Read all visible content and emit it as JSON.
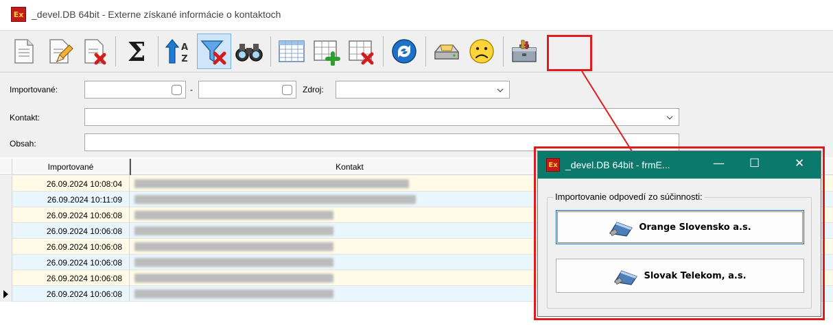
{
  "window": {
    "title": "_devel.DB 64bit - Externe získané informácie o kontaktoch",
    "logo": "Ex"
  },
  "toolbar": {
    "buttons": [
      {
        "icon": "new-document-icon"
      },
      {
        "icon": "edit-document-icon"
      },
      {
        "icon": "delete-document-icon"
      },
      {
        "icon": "sum-icon",
        "glyph": "Σ"
      },
      {
        "icon": "sort-az-icon"
      },
      {
        "icon": "clear-filter-icon",
        "pressed": true
      },
      {
        "icon": "binoculars-icon"
      },
      {
        "icon": "table-icon"
      },
      {
        "icon": "table-add-icon"
      },
      {
        "icon": "table-delete-icon"
      },
      {
        "icon": "refresh-icon"
      },
      {
        "icon": "disk-drive-icon"
      },
      {
        "icon": "sad-face-icon"
      },
      {
        "icon": "toolbox-icon",
        "highlighted": true
      }
    ]
  },
  "filter": {
    "imported_label": "Importované:",
    "dash": "-",
    "source_label": "Zdroj:",
    "contact_label": "Kontakt:",
    "content_label": "Obsah:"
  },
  "grid": {
    "columns": [
      "Importované",
      "Kontakt"
    ],
    "rows": [
      {
        "date": "26.09.2024 10:08:04"
      },
      {
        "date": "26.09.2024 10:11:09"
      },
      {
        "date": "26.09.2024 10:06:08"
      },
      {
        "date": "26.09.2024 10:06:08"
      },
      {
        "date": "26.09.2024 10:06:08"
      },
      {
        "date": "26.09.2024 10:06:08"
      },
      {
        "date": "26.09.2024 10:06:08"
      },
      {
        "date": "26.09.2024 10:06:08",
        "current": true
      }
    ]
  },
  "popup": {
    "title": "_devel.DB 64bit - frmE...",
    "minimize": "—",
    "maximize": "☐",
    "close": "✕",
    "group_label": "Importovanie odpovedí zo súčinnosti:",
    "buttons": [
      {
        "label": "Orange Slovensko a.s.",
        "icon": "usb-drive-icon"
      },
      {
        "label": "Slovak Telekom, a.s.",
        "icon": "usb-drive-icon"
      }
    ]
  },
  "colors": {
    "highlight": "#e01b1b",
    "popup_title": "#0b7a6c",
    "row_yellow": "#fffbe6",
    "row_blue": "#e9f6fd"
  }
}
